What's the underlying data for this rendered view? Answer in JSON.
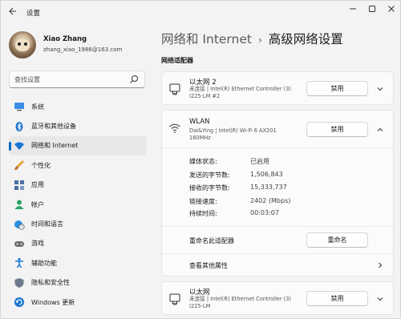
{
  "window": {
    "title": "设置",
    "back_icon": "back-arrow-icon",
    "controls": {
      "minimize": "—",
      "maximize": "☐",
      "close": "✕"
    }
  },
  "user": {
    "name": "Xiao Zhang",
    "email": "zhang_xiao_1986@163.com"
  },
  "search": {
    "placeholder": "查找设置",
    "value": ""
  },
  "sidebar": {
    "items": [
      {
        "label": "系统",
        "icon": "monitor-icon",
        "active": false
      },
      {
        "label": "蓝牙和其他设备",
        "icon": "bluetooth-icon",
        "active": false
      },
      {
        "label": "网络和 Internet",
        "icon": "wifi-icon",
        "active": true
      },
      {
        "label": "个性化",
        "icon": "brush-icon",
        "active": false
      },
      {
        "label": "应用",
        "icon": "apps-icon",
        "active": false
      },
      {
        "label": "帐户",
        "icon": "account-icon",
        "active": false
      },
      {
        "label": "时间和语言",
        "icon": "globe-clock-icon",
        "active": false
      },
      {
        "label": "游戏",
        "icon": "gamepad-icon",
        "active": false
      },
      {
        "label": "辅助功能",
        "icon": "accessibility-icon",
        "active": false
      },
      {
        "label": "隐私和安全性",
        "icon": "shield-icon",
        "active": false
      },
      {
        "label": "Windows 更新",
        "icon": "update-icon",
        "active": false
      }
    ]
  },
  "header": {
    "parent": "网络和 Internet",
    "separator": "›",
    "current": "高级网络设置"
  },
  "section": {
    "label": "网络适配器"
  },
  "adapters": {
    "ethernet2": {
      "name": "以太网 2",
      "desc_line1": "未连接 | Intel(R) Ethernet Controller (3)",
      "desc_line2": "I225-LM #2",
      "button": "禁用",
      "expanded": false
    },
    "wlan": {
      "name": "WLAN",
      "desc_line1": "Dai&Ying | Intel(R) Wi-Fi 6 AX201",
      "desc_line2": "160MHz",
      "button": "禁用",
      "expanded": true,
      "details": [
        {
          "key": "媒体状态:",
          "value": "已启用"
        },
        {
          "key": "发送的字节数:",
          "value": "1,506,843"
        },
        {
          "key": "接收的字节数:",
          "value": "15,333,737"
        },
        {
          "key": "链接速度:",
          "value": "2402 (Mbps)"
        },
        {
          "key": "持续时间:",
          "value": "00:03:07"
        }
      ],
      "rename_label": "重命名此适配器",
      "rename_button": "重命名",
      "more_props": "查看其他属性"
    },
    "ethernet": {
      "name": "以太网",
      "desc_line1": "未连接 | Intel(R) Ethernet Controller (3)",
      "desc_line2": "I225-LM",
      "button": "禁用",
      "expanded": false
    }
  },
  "colors": {
    "accent": "#0067c0",
    "background": "#f3f3f3",
    "card": "#fbfbfb"
  }
}
